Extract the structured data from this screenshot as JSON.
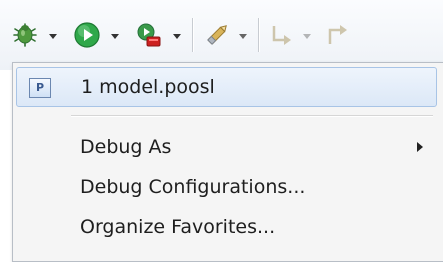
{
  "toolbar": {
    "buttons": [
      {
        "icon": "debug-bug-icon",
        "has_dropdown": true,
        "enabled": true
      },
      {
        "icon": "run-icon",
        "has_dropdown": true,
        "enabled": true
      },
      {
        "icon": "external-tools-icon",
        "has_dropdown": true,
        "enabled": true
      },
      {
        "icon": "pen-icon",
        "has_dropdown": true,
        "enabled": true
      },
      {
        "icon": "next-annotation-icon",
        "has_dropdown": true,
        "enabled": false
      },
      {
        "icon": "previous-annotation-icon",
        "has_dropdown": false,
        "enabled": false
      }
    ]
  },
  "menu": {
    "recent": {
      "label": "1 model.poosl",
      "glyph": "P",
      "icon": "poosl-file-icon"
    },
    "items": [
      {
        "label": "Debug As",
        "has_submenu": true
      },
      {
        "label": "Debug Configurations...",
        "has_submenu": false
      },
      {
        "label": "Organize Favorites...",
        "has_submenu": false
      }
    ]
  },
  "colors": {
    "highlight_bg": "#dce8f7",
    "highlight_border": "#a8c4e6",
    "menu_bg": "#f5f5f5",
    "run_green": "#2fa84a",
    "debug_green": "#3c8a3c"
  }
}
